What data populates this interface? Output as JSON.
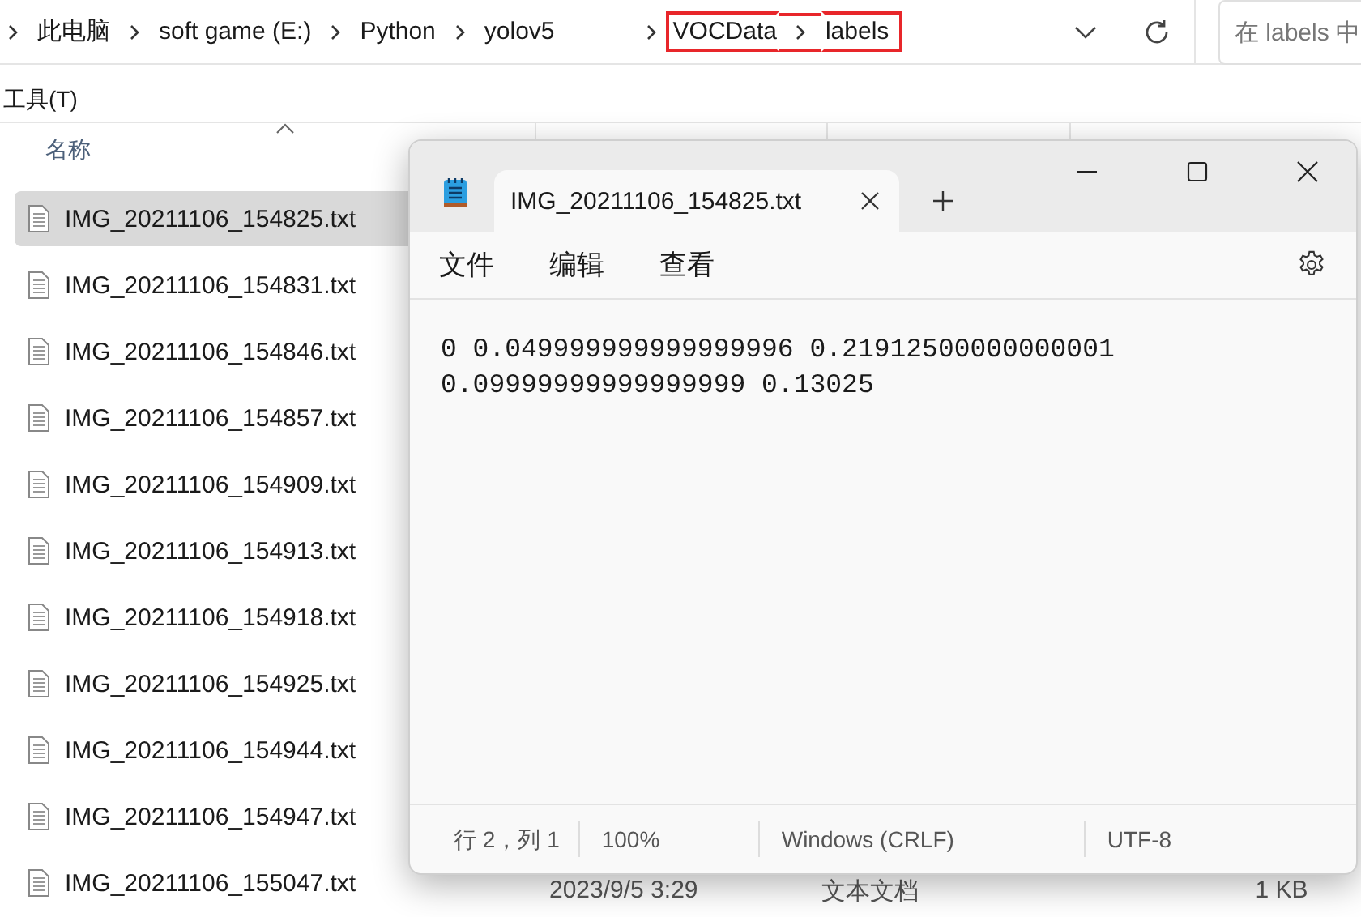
{
  "explorer": {
    "breadcrumb": [
      {
        "label": "此电脑",
        "highlighted": false
      },
      {
        "label": "soft game (E:)",
        "highlighted": false
      },
      {
        "label": "Python",
        "highlighted": false
      },
      {
        "label": "yolov5",
        "highlighted": false
      },
      {
        "label": "VOCData",
        "highlighted": true
      },
      {
        "label": "labels",
        "highlighted": true
      }
    ],
    "search": {
      "placeholder": "在 labels 中"
    },
    "menu": [
      "工具(T)"
    ],
    "columns": [
      "名称"
    ],
    "rows": [
      {
        "name": "IMG_20211106_154825.txt",
        "selected": true
      },
      {
        "name": "IMG_20211106_154831.txt",
        "selected": false
      },
      {
        "name": "IMG_20211106_154846.txt",
        "selected": false
      },
      {
        "name": "IMG_20211106_154857.txt",
        "selected": false
      },
      {
        "name": "IMG_20211106_154909.txt",
        "selected": false
      },
      {
        "name": "IMG_20211106_154913.txt",
        "selected": false
      },
      {
        "name": "IMG_20211106_154918.txt",
        "selected": false
      },
      {
        "name": "IMG_20211106_154925.txt",
        "selected": false
      },
      {
        "name": "IMG_20211106_154944.txt",
        "selected": false
      },
      {
        "name": "IMG_20211106_154947.txt",
        "selected": false
      },
      {
        "name": "IMG_20211106_155047.txt",
        "selected": false,
        "date": "2023/9/5 3:29",
        "type": "文本文档",
        "size": "1 KB"
      }
    ]
  },
  "notepad": {
    "tab": {
      "title": "IMG_20211106_154825.txt"
    },
    "menu": [
      "文件",
      "编辑",
      "查看"
    ],
    "lines": [
      "0 0.049999999999999996 0.21912500000000001",
      "0.09999999999999999 0.13025"
    ],
    "status": [
      "行 2，列 1",
      "100%",
      "Windows (CRLF)",
      "UTF-8"
    ]
  }
}
